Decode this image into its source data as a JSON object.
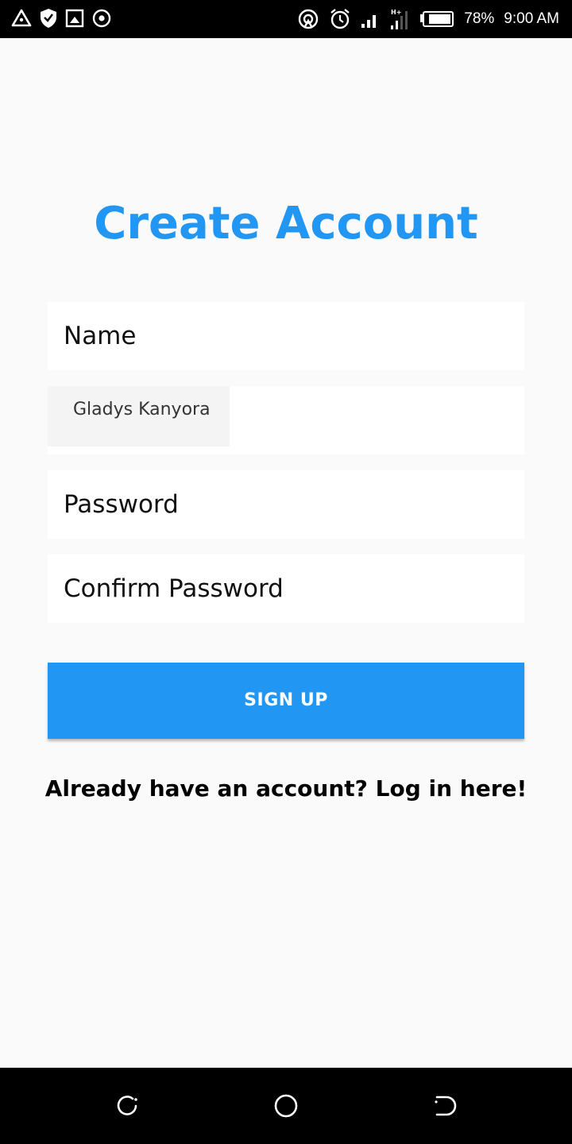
{
  "status_bar": {
    "battery": "78%",
    "time": "9:00 AM",
    "icons_left": [
      "warning-triangle-icon",
      "shield-icon",
      "screenshot-icon",
      "target-icon"
    ],
    "icons_right": [
      "hotspot-icon",
      "alarm-icon",
      "signal-icon",
      "signal-ht-icon",
      "battery-icon"
    ]
  },
  "title": "Create Account",
  "form": {
    "name_label": "Name",
    "name_value": "Gladys Kanyora",
    "password_label": "Password",
    "confirm_password_label": "Confirm Password"
  },
  "signup_label": "SIGN UP",
  "login_text": "Already have an account? Log in here!",
  "nav": {
    "icons": [
      "recent-apps-icon",
      "home-icon",
      "back-icon"
    ]
  },
  "colors": {
    "accent": "#2196f3",
    "background": "#fafafa"
  }
}
